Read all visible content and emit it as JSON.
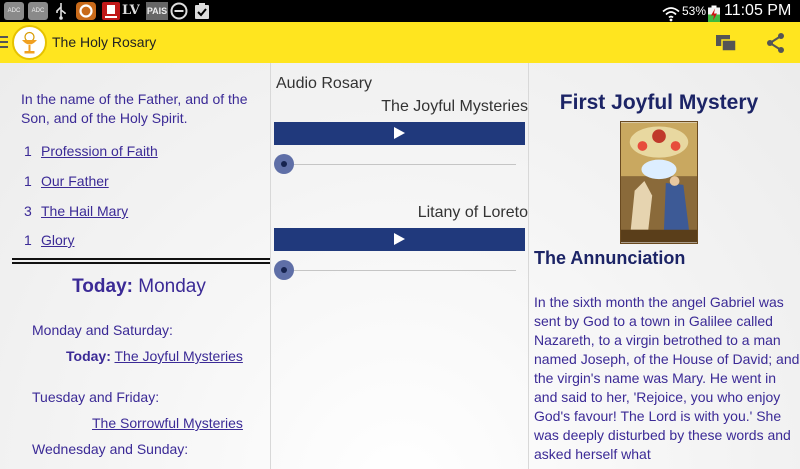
{
  "status_bar": {
    "left_icons": [
      "ADC",
      "ADC",
      "usb-icon",
      "a-circle-icon",
      "news-icon",
      "LV",
      "PAIS",
      "minus-circle-icon",
      "clipboard-check-icon"
    ],
    "lv_text": "LV",
    "pais_text": "PAIS",
    "adc_text": "ADC",
    "battery_percent": "53%",
    "time": "11:05 PM"
  },
  "app_bar": {
    "title": "The Holy Rosary",
    "icons": [
      "menu-icon",
      "chalice-logo",
      "cast-screen-icon",
      "share-icon"
    ]
  },
  "prayers": {
    "intro": "In the name of the Father, and of the Son, and of the Holy Spirit.",
    "items": [
      {
        "count": "1",
        "label": "Profession of Faith"
      },
      {
        "count": "1",
        "label": "Our Father"
      },
      {
        "count": "3",
        "label": "The Hail Mary"
      },
      {
        "count": "1",
        "label": "Glory"
      }
    ]
  },
  "today": {
    "label": "Today:",
    "day": "Monday",
    "schedule": [
      {
        "days": "Monday and Saturday:",
        "prefix": "Today:",
        "mystery": "The Joyful Mysteries"
      },
      {
        "days": "Tuesday and Friday:",
        "prefix": "",
        "mystery": "The Sorrowful Mysteries"
      },
      {
        "days": "Wednesday and Sunday:",
        "prefix": "",
        "mystery": ""
      }
    ]
  },
  "audio": {
    "heading": "Audio Rosary",
    "tracks": [
      {
        "title": "The Joyful Mysteries",
        "progress": 0
      },
      {
        "title": "Litany of Loreto",
        "progress": 0
      }
    ]
  },
  "mystery": {
    "title": "First Joyful Mystery",
    "subtitle": "The Annunciation",
    "text": "In the sixth month the angel Gabriel was sent by God to a town in Galilee called Nazareth, to a virgin betrothed to a man named Joseph, of the House of David; and the virgin's name was Mary. He went in and said to her, 'Rejoice, you who enjoy God's favour! The Lord is with you.' She was deeply disturbed by these words and asked herself what"
  },
  "colors": {
    "app_bar": "#ffe51f",
    "text_purple": "#3b2a96",
    "heading_navy": "#1c2466",
    "play_button": "#20397c"
  }
}
